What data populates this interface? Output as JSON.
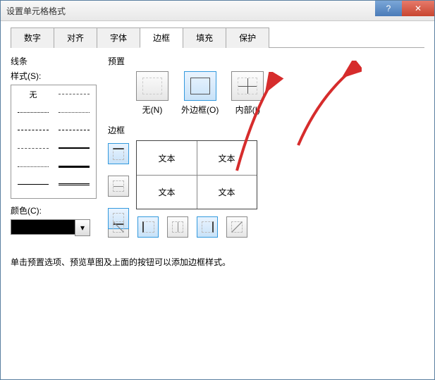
{
  "window": {
    "title": "设置单元格格式"
  },
  "tabs": [
    "数字",
    "对齐",
    "字体",
    "边框",
    "填充",
    "保护"
  ],
  "active_tab": 3,
  "line_section": {
    "label": "线条",
    "style_label": "样式(S):",
    "none_label": "无",
    "color_label": "颜色(C):",
    "color_value": "#000000"
  },
  "preset_section": {
    "label": "预置",
    "items": [
      {
        "label": "无(N)",
        "cls": "mg-none"
      },
      {
        "label": "外边框(O)",
        "cls": "mg-outer",
        "selected": true
      },
      {
        "label": "内部(I)",
        "cls": "mg-inner"
      }
    ]
  },
  "border_section": {
    "label": "边框"
  },
  "preview_cells": [
    "文本",
    "文本",
    "文本",
    "文本"
  ],
  "hint": "单击预置选项、预览草图及上面的按钮可以添加边框样式。",
  "side_btns": [
    "sq-top",
    "sq-mid",
    "sq-bot"
  ],
  "bottom_btns": [
    "sq-diag1",
    "sq-left",
    "sq-vmid",
    "sq-right",
    "sq-diag2"
  ]
}
